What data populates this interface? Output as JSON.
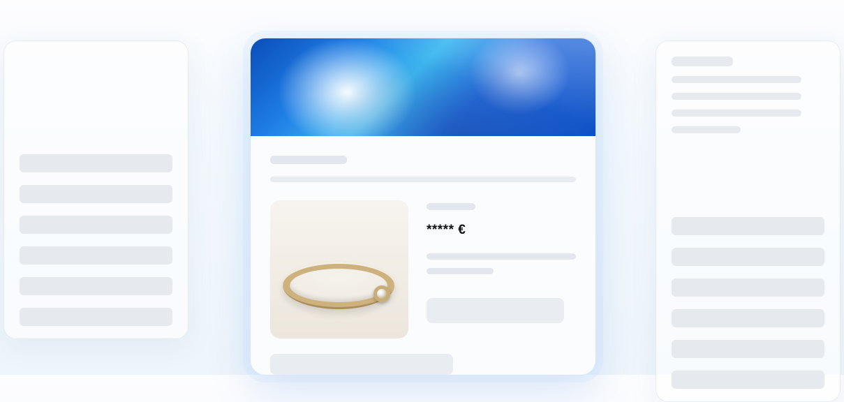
{
  "product": {
    "price_masked": "***** €",
    "image_alt": "gold-ring-with-gem"
  }
}
